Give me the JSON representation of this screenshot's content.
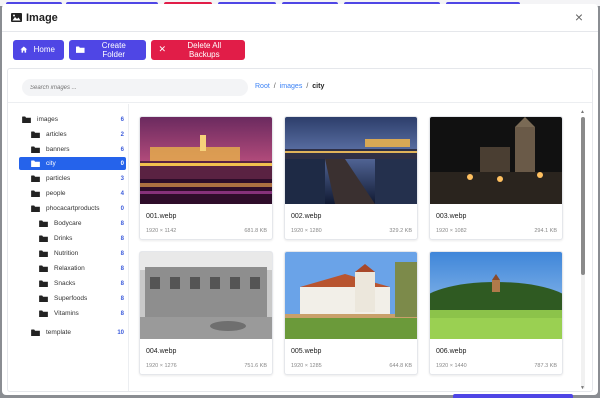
{
  "modal": {
    "title": "Image",
    "close_label": "×"
  },
  "toolbar": {
    "home_label": "Home",
    "create_folder_label": "Create Folder",
    "delete_backups_label": "Delete All Backups"
  },
  "search": {
    "placeholder": "Search images ..."
  },
  "breadcrumb": {
    "root": "Root",
    "sep1": "/",
    "images": "images",
    "sep2": "/",
    "current": "city"
  },
  "tree": [
    {
      "label": "images",
      "count": "6"
    },
    {
      "label": "articles",
      "count": "2"
    },
    {
      "label": "banners",
      "count": "6"
    },
    {
      "label": "city",
      "count": "0",
      "active": true
    },
    {
      "label": "particles",
      "count": "3"
    },
    {
      "label": "people",
      "count": "4"
    },
    {
      "label": "phocacartproducts",
      "count": "0"
    },
    {
      "label": "Bodycare",
      "count": "8"
    },
    {
      "label": "Drinks",
      "count": "8"
    },
    {
      "label": "Nutrition",
      "count": "8"
    },
    {
      "label": "Relaxation",
      "count": "8"
    },
    {
      "label": "Snacks",
      "count": "8"
    },
    {
      "label": "Superfoods",
      "count": "8"
    },
    {
      "label": "Vitamins",
      "count": "8"
    },
    {
      "label": "template",
      "count": "10"
    }
  ],
  "files": [
    {
      "name": "001.webp",
      "dims": "1920 × 1142",
      "size": "681.8 KB"
    },
    {
      "name": "002.webp",
      "dims": "1920 × 1280",
      "size": "329.2 KB"
    },
    {
      "name": "003.webp",
      "dims": "1920 × 1082",
      "size": "294.1 KB"
    },
    {
      "name": "004.webp",
      "dims": "1920 × 1276",
      "size": "751.6 KB"
    },
    {
      "name": "005.webp",
      "dims": "1920 × 1285",
      "size": "644.8 KB"
    },
    {
      "name": "006.webp",
      "dims": "1920 × 1440",
      "size": "787.3 KB"
    }
  ],
  "colors": {
    "primary": "#4f46e5",
    "danger": "#e11d48",
    "active": "#2563eb"
  },
  "icons": {
    "title": "image-icon",
    "home": "home-icon",
    "folder": "folder-icon",
    "delete": "x-icon",
    "close": "close-icon"
  }
}
